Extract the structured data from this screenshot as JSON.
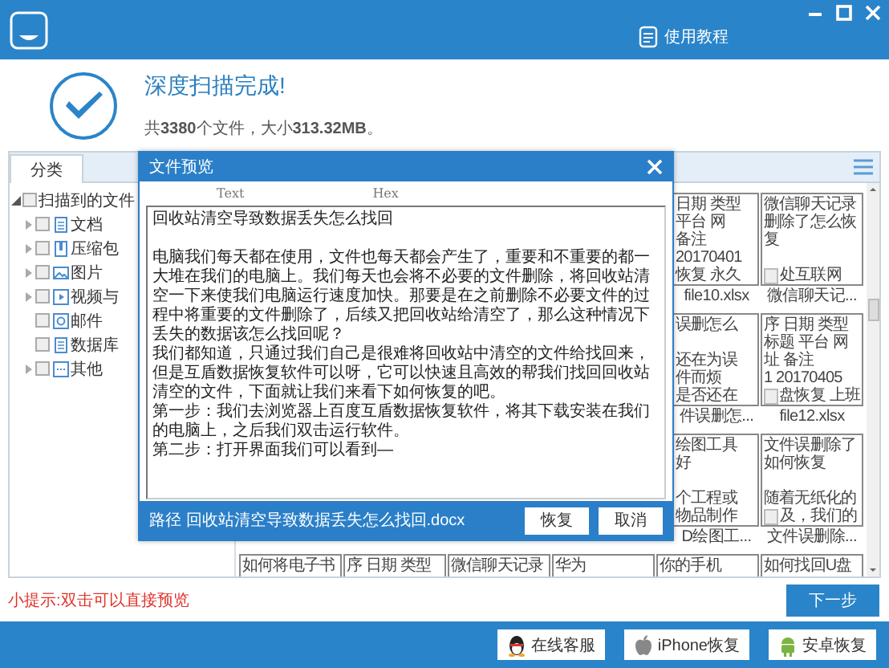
{
  "header": {
    "help_button": "使用教程"
  },
  "summary": {
    "title": "深度扫描完成!",
    "subtitle": "共**3380**个文件，大小**313.32MB**。"
  },
  "category_tab": {
    "label": "分类",
    "selected": true
  },
  "tree": {
    "label": "扫描到的文件",
    "checked": false,
    "expanded": true,
    "children": [
      {
        "label": "文档",
        "kind": "document",
        "checked": false,
        "expandable": true
      },
      {
        "label": "压缩包",
        "kind": "archive",
        "checked": false,
        "expandable": true
      },
      {
        "label": "图片",
        "kind": "image",
        "checked": false,
        "expandable": true
      },
      {
        "label": "视频与",
        "kind": "video",
        "checked": false,
        "expandable": true
      },
      {
        "label": "邮件",
        "kind": "mail",
        "checked": false,
        "expandable": false
      },
      {
        "label": "数据库",
        "kind": "database",
        "checked": false,
        "expandable": false
      },
      {
        "label": "其他",
        "kind": "other",
        "checked": false,
        "expandable": true
      }
    ]
  },
  "file_grid": {
    "rows": [
      {
        "cards": [
          {
            "blocks": [
              [
                "日期 类型",
                "平台 网",
                "备注",
                "20170401",
                "恢复 永久"
              ]
            ],
            "label": "file10.xlsx",
            "cut": true,
            "footer_icon": false
          },
          {
            "blocks": [
              [
                "微信聊天记录",
                "删除了怎么恢",
                "复"
              ],
              [
                "处互联网"
              ]
            ],
            "label": "微信聊天记...",
            "cut": false,
            "footer_icon": true
          }
        ]
      },
      {
        "cards": [
          {
            "blocks": [
              [
                "误删怎么"
              ],
              [
                "还在为误",
                "件而烦",
                "是否还在"
              ]
            ],
            "label": "件误删怎...",
            "cut": true,
            "footer_icon": false
          },
          {
            "blocks": [
              [
                "序 日期 类型",
                "标题 平台 网",
                "址 备注",
                "1 20170405",
                "盘恢复 上班"
              ]
            ],
            "label": "file12.xlsx",
            "cut": false,
            "footer_icon": true
          }
        ]
      },
      {
        "cards": [
          {
            "blocks": [
              [
                "绘图工具",
                "好"
              ],
              [
                "个工程或",
                "物品制作"
              ]
            ],
            "label": "D绘图工...",
            "cut": true,
            "footer_icon": false
          },
          {
            "blocks": [
              [
                "文件误删除了",
                "如何恢复"
              ],
              [
                "随着无纸化的",
                "及，我们的"
              ]
            ],
            "label": "文件误删除...",
            "cut": false,
            "footer_icon": true
          }
        ]
      },
      {
        "cards": [
          {
            "blocks": [
              [
                "如何将电子书"
              ]
            ],
            "cut": false,
            "footer_icon": false
          },
          {
            "blocks": [
              [
                "序 日期 类型"
              ]
            ],
            "cut": false,
            "footer_icon": false
          },
          {
            "blocks": [
              [
                "微信聊天记录"
              ]
            ],
            "cut": false,
            "footer_icon": false
          },
          {
            "blocks": [
              [
                "华为"
              ]
            ],
            "cut": false,
            "footer_icon": false
          },
          {
            "blocks": [
              [
                "你的手机"
              ]
            ],
            "cut": false,
            "footer_icon": false
          },
          {
            "blocks": [
              [
                "如何找回U盘"
              ]
            ],
            "cut": false,
            "footer_icon": false
          }
        ]
      }
    ]
  },
  "tip": "小提示:双击可以直接预览",
  "next_button": "下一步",
  "footer_buttons": [
    {
      "label": "在线客服",
      "kind": "qq"
    },
    {
      "label": "iPhone恢复",
      "kind": "apple"
    },
    {
      "label": "安卓恢复",
      "kind": "android"
    }
  ],
  "dialog": {
    "title": "文件预览",
    "tabs": [
      {
        "label": "Text"
      },
      {
        "label": "Hex"
      }
    ],
    "paragraphs": [
      "回收站清空导致数据丢失怎么找回",
      "电脑我们每天都在使用，文件也每天都会产生了，重要和不重要的都一大堆在我们的电脑上。我们每天也会将不必要的文件删除，将回收站清空一下来使我们电脑运行速度加快。那要是在之前删除不必要文件的过程中将重要的文件删除了，后续又把回收站给清空了，那么这种情况下丢失的数据该怎么找回呢？",
      "我们都知道，只通过我们自己是很难将回收站中清空的文件给找回来，但是互盾数据恢复软件可以呀，它可以快速且高效的帮我们找回回收站清空的文件，下面就让我们来看下如何恢复的吧。",
      "第一步：我们去浏览器上百度互盾数据恢复软件，将其下载安装在我们的电脑上，之后我们双击运行软件。",
      "第二步：打开界面我们可以看到—"
    ],
    "path": "路径 回收站清空导致数据丢失怎么找回.docx",
    "buttons": [
      "恢复",
      "取消"
    ]
  }
}
